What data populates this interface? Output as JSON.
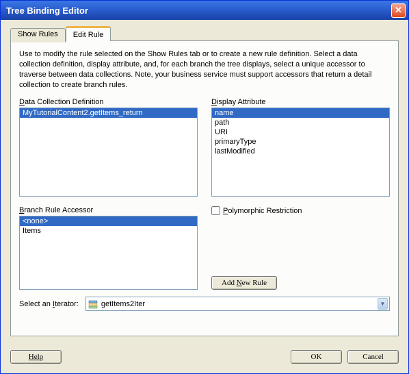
{
  "title": "Tree Binding Editor",
  "tabs": {
    "show": "Show Rules",
    "edit": "Edit Rule"
  },
  "intro": "Use to modify the rule selected on the Show Rules tab or to create a new rule definition. Select a data collection definition, display attribute, and, for each branch the tree displays, select a unique accessor to traverse between data collections. Note, your business service must support accessors that return a detail collection to create branch rules.",
  "labels": {
    "dcd_u": "D",
    "dcd_rest": "ata Collection Definition",
    "da_u": "D",
    "da_rest": "isplay Attribute",
    "bra_u": "B",
    "bra_rest": "ranch Rule Accessor",
    "poly_u": "P",
    "poly_rest": "olymorphic Restriction",
    "iter_pre": "Select an ",
    "iter_u": "I",
    "iter_post": "terator:",
    "add_pre": "Add ",
    "add_u": "N",
    "add_post": "ew Rule",
    "help": "Help",
    "ok": "OK",
    "cancel": "Cancel"
  },
  "dcd": {
    "items": [
      "MyTutorialContent2.getItems_return"
    ],
    "selected": 0
  },
  "display_attr": {
    "items": [
      "name",
      "path",
      "URI",
      "primaryType",
      "lastModified"
    ],
    "selected": 0
  },
  "branch": {
    "items": [
      "<none>",
      "Items"
    ],
    "selected": 0
  },
  "iterator": {
    "value": "getItems2Iter"
  }
}
